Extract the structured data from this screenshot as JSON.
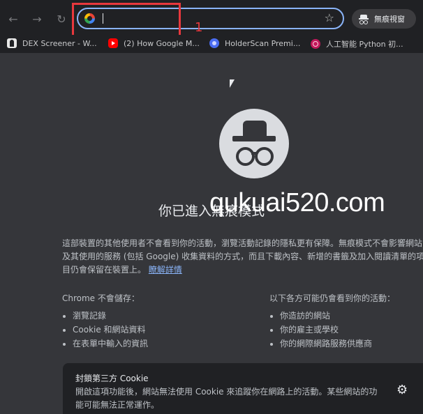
{
  "toolbar": {
    "back_icon": "←",
    "forward_icon": "→",
    "reload_icon": "↻",
    "omnibox_value": "",
    "star_icon": "☆",
    "incognito_label": "無痕視窗"
  },
  "annotation": {
    "number": "1",
    "color": "#e8383d"
  },
  "bookmarks": [
    {
      "label": "DEX Screener - W..."
    },
    {
      "label": "(2) How Google M..."
    },
    {
      "label": "HolderScan Premi..."
    },
    {
      "label": "人工智能 Python 初..."
    }
  ],
  "main": {
    "headline": "你已進入無痕模式",
    "watermark": "qukuai520.com",
    "description": "這部裝置的其他使用者不會看到你的活動，瀏覽活動記錄的隱私更有保障。無痕模式不會影響網站及其使用的服務 (包括 Google) 收集資料的方式，而且下載內容、新增的書籤及加入閱讀清單的項目仍會保留在裝置上。",
    "learn_more": "瞭解詳情",
    "not_saved": {
      "title": "Chrome 不會儲存：",
      "items": [
        "瀏覽記錄",
        "Cookie 和網站資料",
        "在表單中輸入的資訊"
      ]
    },
    "may_see": {
      "title": "以下各方可能仍會看到你的活動：",
      "items": [
        "你造訪的網站",
        "你的雇主或學校",
        "你的網際網路服務供應商"
      ]
    },
    "cookie_card": {
      "title": "封鎖第三方 Cookie",
      "description": "開啟這項功能後，網站無法使用 Cookie 來追蹤你在網路上的活動。某些網站的功能可能無法正常運作。",
      "settings_icon": "⚙"
    }
  },
  "colors": {
    "page_bg": "#35363a",
    "toolbar_bg": "#202124",
    "accent": "#8ab4f8"
  }
}
